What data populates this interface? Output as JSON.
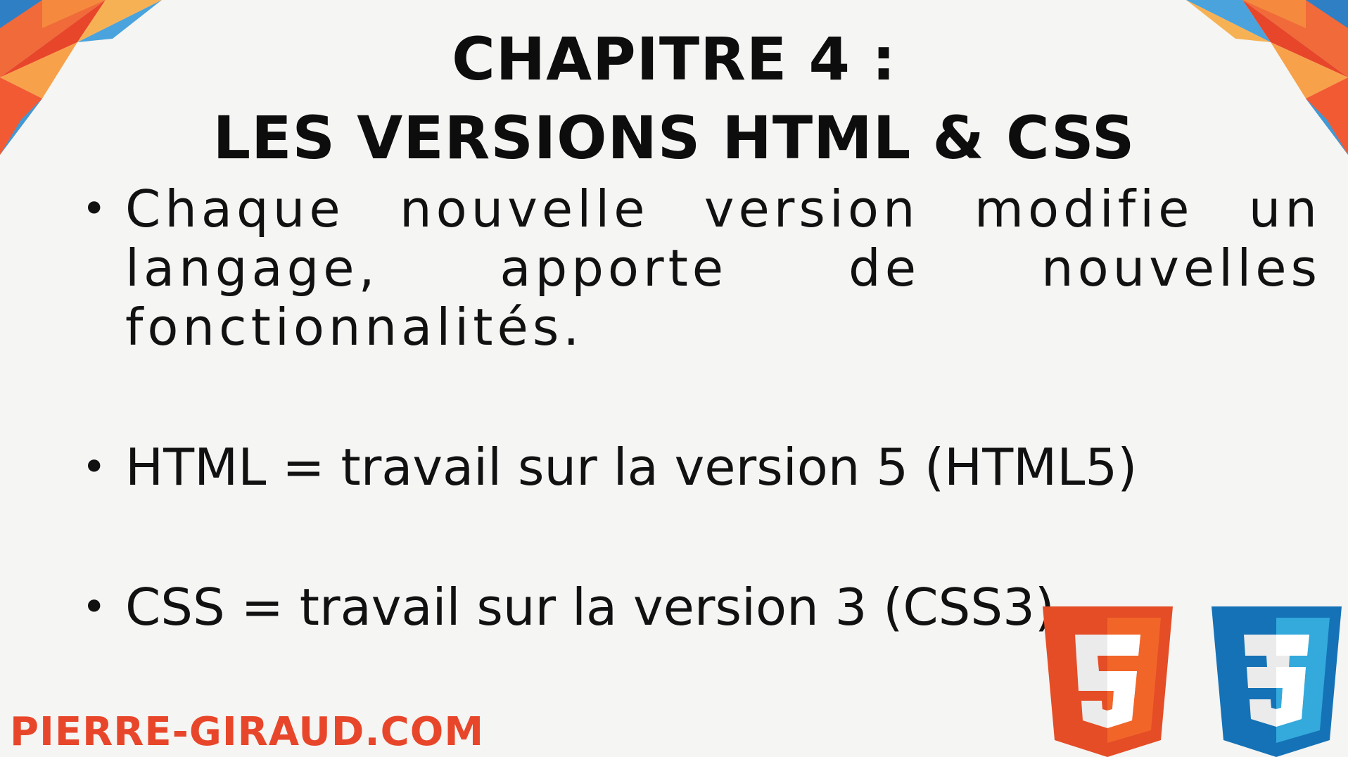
{
  "slide": {
    "title_line1": "CHAPITRE 4 :",
    "title_line2": "LES VERSIONS HTML & CSS",
    "bullets": [
      "Chaque nouvelle version modifie un langage, apporte de nouvelles fonctionnalités.",
      "HTML = travail sur la version 5 (HTML5)",
      "CSS = travail sur la version 3 (CSS3)"
    ],
    "bullet_symbol": "•",
    "brand": "PIERRE-GIRAUD.COM",
    "logos": {
      "html5_digit": "5",
      "css3_digit": "3"
    }
  },
  "colors": {
    "background": "#f5f5f3",
    "text": "#111111",
    "brand": "#e8462a",
    "html5_orange": "#e44d26",
    "html5_light": "#f16529",
    "css3_blue": "#1572b6",
    "css3_light": "#33a9dc"
  },
  "icons": [
    "corner-triangles-left",
    "corner-triangles-right",
    "html5-shield-logo",
    "css3-shield-logo"
  ]
}
